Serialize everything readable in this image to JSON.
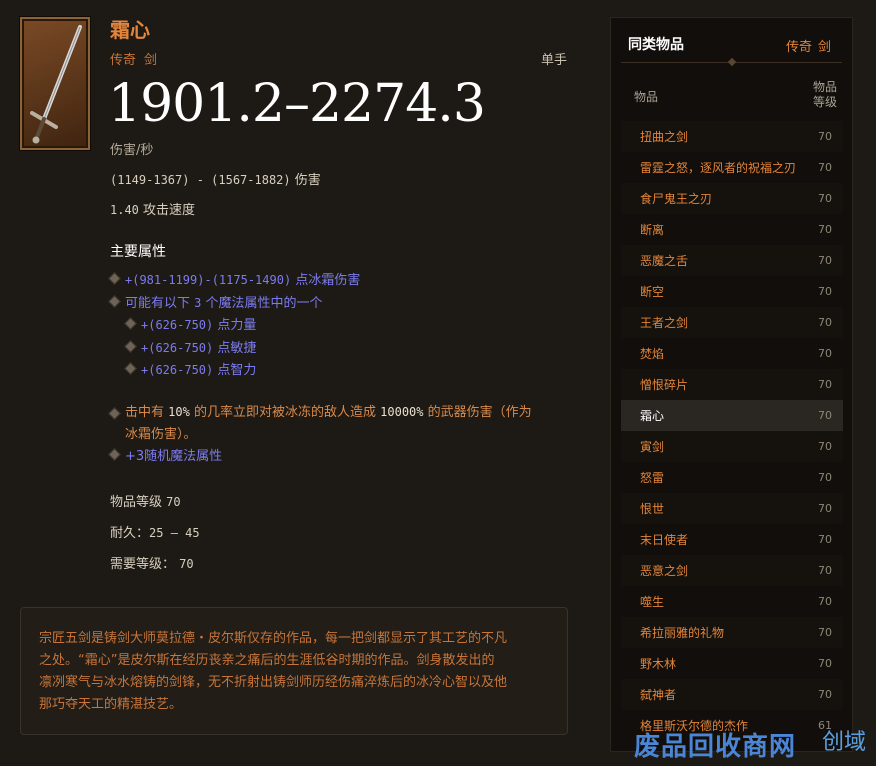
{
  "item": {
    "name": "霜心",
    "rarity": "传奇",
    "type": "剑",
    "hand": "单手",
    "dps": "1901.2–2274.3",
    "dps_label": "伤害/秒",
    "damage_range": "(1149-1367) - (1567-1882)",
    "damage_suffix": "伤害",
    "attack_speed": "1.40",
    "attack_speed_label": "攻击速度",
    "primary_title": "主要属性",
    "props": {
      "cold_damage_value": "+(981-1199)-(1175-1490)",
      "cold_damage_text": "点冰霜伤害",
      "magic_pre": "可能有以下",
      "magic_count": "3",
      "magic_post": "个魔法属性中的一个",
      "str_value": "+(626-750)",
      "str_text": "点力量",
      "dex_value": "+(626-750)",
      "dex_text": "点敏捷",
      "int_value": "+(626-750)",
      "int_text": "点智力",
      "proc_1": "击中有",
      "proc_pct": "10%",
      "proc_2": "的几率立即对被冰冻的敌人造成",
      "proc_dmg": "10000%",
      "proc_3": "的武器伤害（作为",
      "proc_4": "冰霜伤害）。",
      "random_magic": "+3随机魔法属性"
    },
    "item_level_label": "物品等级",
    "item_level": "70",
    "durability_label": "耐久：",
    "durability": "25 – 45",
    "required_level_label": "需要等级：",
    "required_level": "70",
    "flavor": [
      "宗匠五剑是铸剑大师莫拉德・皮尔斯仅存的作品，每一把剑都显示了其工艺的不凡",
      "之处。“霜心”是皮尔斯在经历丧亲之痛后的生涯低谷时期的作品。剑身散发出的",
      "凛冽寒气与冰水熔铸的剑锋，无不折射出铸剑师历经伤痛淬炼后的冰冷心智以及他",
      "那巧夺天工的精湛技艺。"
    ]
  },
  "sidebar": {
    "title": "同类物品",
    "category_rarity": "传奇",
    "category_type": "剑",
    "col_item": "物品",
    "col_level": "物品等级",
    "items": [
      {
        "name": "扭曲之剑",
        "level": "70"
      },
      {
        "name": "雷霆之怒，逐风者的祝福之刃",
        "level": "70"
      },
      {
        "name": "食尸鬼王之刃",
        "level": "70"
      },
      {
        "name": "断离",
        "level": "70"
      },
      {
        "name": "恶魔之舌",
        "level": "70"
      },
      {
        "name": "断空",
        "level": "70"
      },
      {
        "name": "王者之剑",
        "level": "70"
      },
      {
        "name": "焚焰",
        "level": "70"
      },
      {
        "name": "憎恨碎片",
        "level": "70"
      },
      {
        "name": "霜心",
        "level": "70",
        "selected": true
      },
      {
        "name": "寅剑",
        "level": "70"
      },
      {
        "name": "怒雷",
        "level": "70"
      },
      {
        "name": "恨世",
        "level": "70"
      },
      {
        "name": "末日使者",
        "level": "70"
      },
      {
        "name": "恶意之剑",
        "level": "70"
      },
      {
        "name": "噬生",
        "level": "70"
      },
      {
        "name": "希拉丽雅的礼物",
        "level": "70"
      },
      {
        "name": "野木林",
        "level": "70"
      },
      {
        "name": "弑神者",
        "level": "70"
      },
      {
        "name": "格里斯沃尔德的杰作",
        "level": "61"
      }
    ]
  },
  "watermark": {
    "text": "废品回收商网",
    "extra": "创域"
  },
  "colors": {
    "legendary": "#e3853a",
    "magic_blue": "#7c7cf0",
    "background": "#1d1914"
  }
}
